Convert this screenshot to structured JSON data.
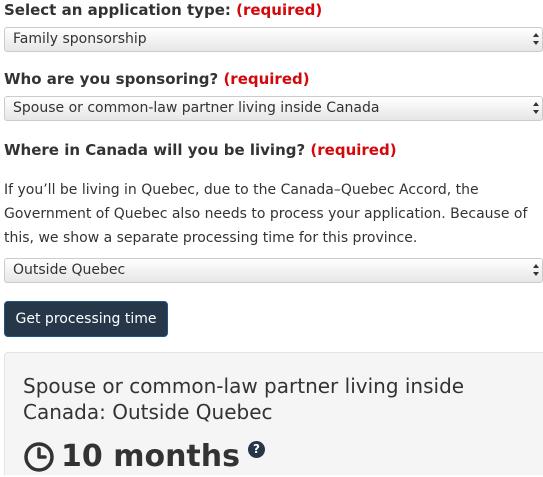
{
  "required_text": "(required)",
  "fields": {
    "application_type": {
      "label": "Select an application type:",
      "value": "Family sponsorship"
    },
    "sponsoring": {
      "label": "Who are you sponsoring?",
      "value": "Spouse or common-law partner living inside Canada"
    },
    "location": {
      "label": "Where in Canada will you be living?",
      "value": "Outside Quebec"
    }
  },
  "explanation": "If you’ll be living in Quebec, due to the Canada–Quebec Accord, the Government of Quebec also needs to process your application. Because of this, we show a separate processing time for this province.",
  "submit_button": "Get processing time",
  "result": {
    "title": "Spouse or common-law partner living inside Canada: Outside Quebec",
    "time": "10 months",
    "clock_icon": "clock-icon",
    "help_icon": "question-circle-icon",
    "help_glyph": "?"
  },
  "colors": {
    "required": "#d3080c",
    "button": "#26374a",
    "panel": "#f5f5f5"
  }
}
